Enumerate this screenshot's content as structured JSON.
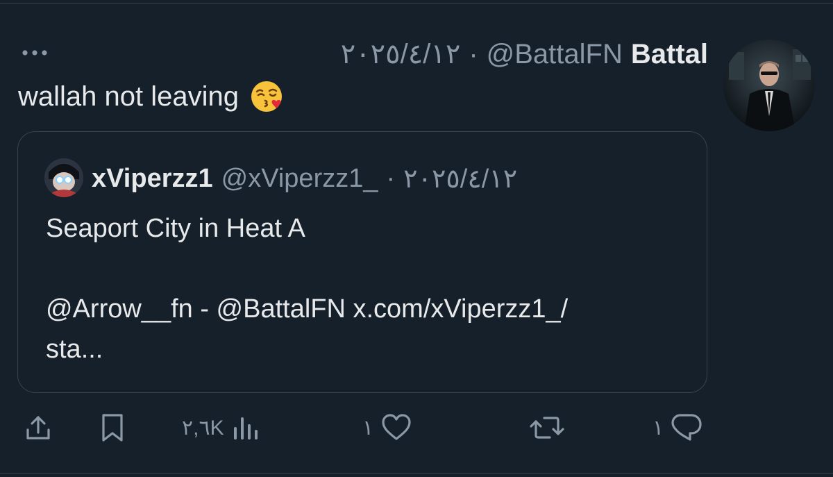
{
  "tweet": {
    "display_name": "Battal",
    "handle": "@BattalFN",
    "separator": "·",
    "timestamp": "٢٠٢٥/٤/١٢",
    "text": "wallah not leaving",
    "emoji": "face-blowing-a-kiss"
  },
  "quote": {
    "display_name": "xViperzz1",
    "handle": "@xViperzz1_",
    "separator": "·",
    "timestamp": "٢٠٢٥/٤/١٢",
    "lines": [
      "Seaport City in Heat A",
      "",
      "@Arrow__fn - @BattalFN x.com/xViperzz1_/",
      "sta..."
    ]
  },
  "actions": {
    "share_icon": "share-icon",
    "bookmark_icon": "bookmark-icon",
    "views_count": "٢,٦K",
    "likes_count": "١",
    "retweet_icon": "retweet-icon",
    "replies_count": "١"
  },
  "colors": {
    "background": "#15202b",
    "text_primary": "#e7e9ea",
    "text_secondary": "#8b98a5",
    "border": "#38444d"
  }
}
